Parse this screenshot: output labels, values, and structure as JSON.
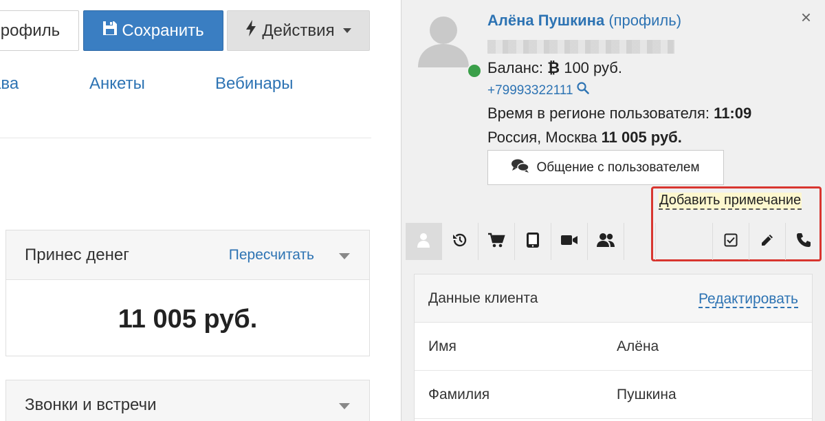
{
  "toolbar": {
    "profile_label": "профиль",
    "save_label": "Сохранить",
    "actions_label": "Действия"
  },
  "nav": {
    "rights": "ава",
    "forms": "Анкеты",
    "webinars": "Вебинары"
  },
  "cards": {
    "money": {
      "title": "Принес денег",
      "link": "Пересчитать",
      "amount": "11 005 руб."
    },
    "calls": {
      "title": "Звонки и встречи"
    }
  },
  "user": {
    "name": "Алёна Пушкина",
    "profile_link": "(профиль)",
    "balance_label": "Баланс:",
    "balance_value": "100 руб.",
    "phone": "+79993322111",
    "region_time_label": "Время в регионе пользователя:",
    "region_time_value": "11:09",
    "location": "Россия, Москва",
    "location_amount": "11 005 руб.",
    "chat_button": "Общение с пользователем",
    "add_note": "Добавить примечание"
  },
  "client": {
    "title": "Данные клиента",
    "edit_link": "Редактировать",
    "rows": [
      {
        "label": "Имя",
        "value": "Алёна"
      },
      {
        "label": "Фамилия",
        "value": "Пушкина"
      }
    ]
  },
  "colors": {
    "primary": "#3a7ec2",
    "link": "#2d73b3",
    "online": "#3a9f49",
    "highlight": "#d8352f"
  }
}
